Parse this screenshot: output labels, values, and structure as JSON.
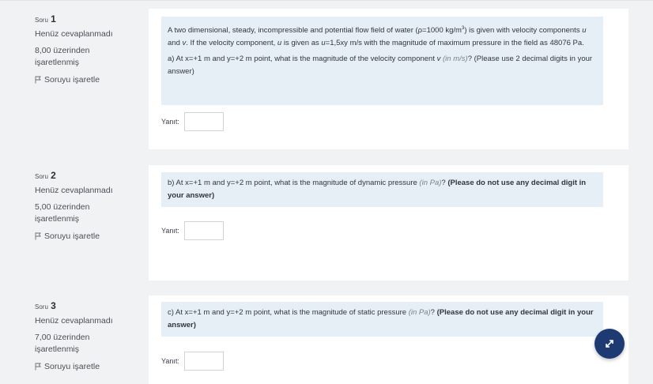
{
  "questions": [
    {
      "soru_label": "Soru",
      "number": "1",
      "status": "Henüz cevaplanmadı",
      "grade_line1": "8,00 üzerinden",
      "grade_line2": "işaretlenmiş",
      "flag_label": "Soruyu işaretle",
      "prompt": {
        "p1_a": "A two dimensional, steady, incompressible and potential flow field of water (ρ=1000 kg/m",
        "p1_sup": "3",
        "p1_b": ") is given with velocity components ",
        "p1_u": "u",
        "p1_c": " and ",
        "p1_v": "v",
        "p1_d": ". If the velocity component, ",
        "p1_u2": "u",
        "p1_e": " is given as ",
        "p1_u3": "u",
        "p1_f": "=1,5xy  m/s  with the magnitude of maximum pressure in the field as 48076 Pa.",
        "p2_a": "a) At x=+1 m and y=+2 m point, what is the magnitude of the velocity component ",
        "p2_v": "v",
        "p2_unit": "(in m/s)",
        "p2_b": "? (Please use 2 decimal digits in your answer)"
      },
      "answer_label": "Yanıt:",
      "answer_value": ""
    },
    {
      "soru_label": "Soru",
      "number": "2",
      "status": "Henüz cevaplanmadı",
      "grade_line1": "5,00 üzerinden",
      "grade_line2": "işaretlenmiş",
      "flag_label": "Soruyu işaretle",
      "prompt": {
        "a": "b) At x=+1 m and y=+2 m point, what is the magnitude of dynamic pressure  ",
        "unit": "(in Pa)",
        "b": "? ",
        "bold": "(Please do not use any decimal digit in your answer)"
      },
      "answer_label": "Yanıt:",
      "answer_value": ""
    },
    {
      "soru_label": "Soru",
      "number": "3",
      "status": "Henüz cevaplanmadı",
      "grade_line1": "7,00 üzerinden",
      "grade_line2": "işaretlenmiş",
      "flag_label": "Soruyu işaretle",
      "prompt": {
        "a": "c) At x=+1 m and y=+2 m point, what is the magnitude of static pressure ",
        "unit": "(in Pa)",
        "b": "? ",
        "bold": "(Please do not use any decimal digit in your answer)"
      },
      "answer_label": "Yanıt:",
      "answer_value": ""
    }
  ],
  "fab_icon": "expand-arrows-icon",
  "colors": {
    "background": "#f1f2f4",
    "card": "#ffffff",
    "prompt_bg": "#e7eff6",
    "fab": "#1d3a73"
  }
}
